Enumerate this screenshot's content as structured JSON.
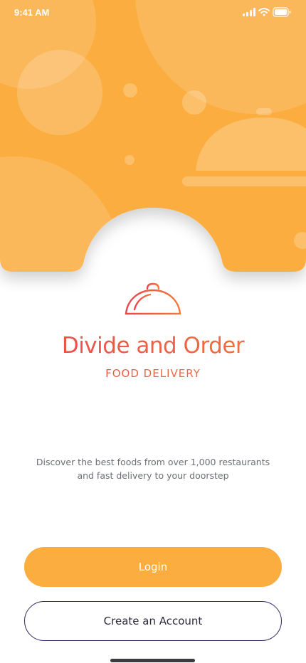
{
  "status_bar": {
    "time": "9:41 AM",
    "icons": [
      "signal-icon",
      "wifi-icon",
      "battery-icon"
    ]
  },
  "brand": {
    "name": "Divide and Order",
    "tagline": "FOOD DELIVERY",
    "logo_icon": "cloche-icon"
  },
  "description": "Discover the best foods from over 1,000 restaurants and fast delivery to your doorstep",
  "actions": {
    "login_label": "Login",
    "create_account_label": "Create an Account"
  },
  "colors": {
    "header": "#fbad3f",
    "accent_gradient_start": "#e8464f",
    "accent_gradient_end": "#f07a3a",
    "primary_button": "#fbad3f",
    "secondary_button_border": "#2f2a63"
  }
}
